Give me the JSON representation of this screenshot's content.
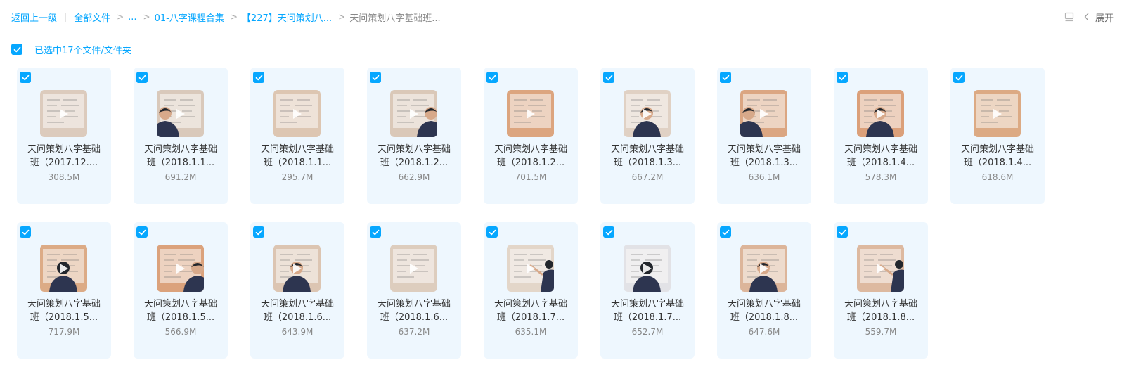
{
  "breadcrumb": {
    "back": "返回上一级",
    "all_files": "全部文件",
    "ellipsis": "...",
    "folder1": "01-八字课程合集",
    "folder2": "【227】天问策划八...",
    "current": "天问策划八字基础班..."
  },
  "toolbar": {
    "expand_label": "展开",
    "view_icon": "list-view-icon",
    "collapse_icon": "chevron-left-icon"
  },
  "selection": {
    "label": "已选中17个文件/文件夹",
    "checked": true
  },
  "colors": {
    "accent": "#06a7ff",
    "card_bg": "#eef7fe"
  },
  "files": [
    {
      "line1": "天问策划八字基础",
      "line2": "班（2017.12....",
      "size": "308.5M",
      "person": "none",
      "tone": "#dccbbd"
    },
    {
      "line1": "天问策划八字基础",
      "line2": "班（2018.1.1...",
      "size": "691.2M",
      "person": "left",
      "tone": "#d9c9bb"
    },
    {
      "line1": "天问策划八字基础",
      "line2": "班（2018.1.1...",
      "size": "295.7M",
      "person": "none",
      "tone": "#ddc6b2"
    },
    {
      "line1": "天问策划八字基础",
      "line2": "班（2018.1.2...",
      "size": "662.9M",
      "person": "right",
      "tone": "#dac8b8"
    },
    {
      "line1": "天问策划八字基础",
      "line2": "班（2018.1.2...",
      "size": "701.5M",
      "person": "none",
      "tone": "#dca57f"
    },
    {
      "line1": "天问策划八字基础",
      "line2": "班（2018.1.3...",
      "size": "667.2M",
      "person": "center",
      "tone": "#e0d1c4"
    },
    {
      "line1": "天问策划八字基础",
      "line2": "班（2018.1.3...",
      "size": "636.1M",
      "person": "left",
      "tone": "#dba682"
    },
    {
      "line1": "天问策划八字基础",
      "line2": "班（2018.1.4...",
      "size": "578.3M",
      "person": "center",
      "tone": "#dba07a"
    },
    {
      "line1": "天问策划八字基础",
      "line2": "班（2018.1.4...",
      "size": "618.6M",
      "person": "none",
      "tone": "#dcaa84"
    },
    {
      "line1": "天问策划八字基础",
      "line2": "班（2018.1.5...",
      "size": "717.9M",
      "person": "back",
      "tone": "#dcab86"
    },
    {
      "line1": "天问策划八字基础",
      "line2": "班（2018.1.5...",
      "size": "566.9M",
      "person": "right",
      "tone": "#dba27c"
    },
    {
      "line1": "天问策划八字基础",
      "line2": "班（2018.1.6...",
      "size": "643.9M",
      "person": "center",
      "tone": "#dcc5b2"
    },
    {
      "line1": "天问策划八字基础",
      "line2": "班（2018.1.6...",
      "size": "637.2M",
      "person": "none",
      "tone": "#ddcdbe"
    },
    {
      "line1": "天问策划八字基础",
      "line2": "班（2018.1.7...",
      "size": "635.1M",
      "person": "arm",
      "tone": "#e3d6c9"
    },
    {
      "line1": "天问策划八字基础",
      "line2": "班（2018.1.7...",
      "size": "652.7M",
      "person": "back",
      "tone": "#e2e2e6"
    },
    {
      "line1": "天问策划八字基础",
      "line2": "班（2018.1.8...",
      "size": "647.6M",
      "person": "center",
      "tone": "#dcb59a"
    },
    {
      "line1": "天问策划八字基础",
      "line2": "班（2018.1.8...",
      "size": "559.7M",
      "person": "arm",
      "tone": "#ddb9a0"
    }
  ]
}
